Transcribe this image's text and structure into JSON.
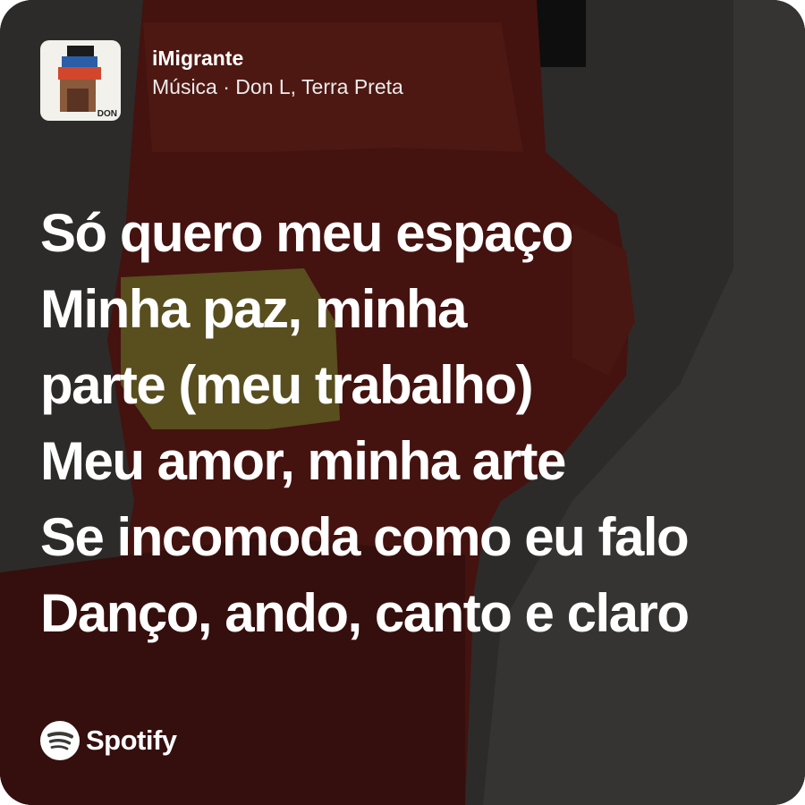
{
  "track": {
    "title": "iMigrante",
    "subtitle": "Música · Don L, Terra Preta",
    "cover_text": "DON"
  },
  "lyrics": [
    "Só quero meu espaço",
    "Minha paz, minha",
    "parte (meu trabalho)",
    "Meu amor, minha arte",
    "Se incomoda como eu falo",
    "Danço, ando, canto e claro"
  ],
  "brand": {
    "name": "Spotify",
    "icon": "spotify-logo-icon"
  },
  "colors": {
    "background_dark": "#3b3a38",
    "art_red": "#6b1f1a",
    "art_yellow": "#8a7a2a",
    "text": "#ffffff"
  }
}
